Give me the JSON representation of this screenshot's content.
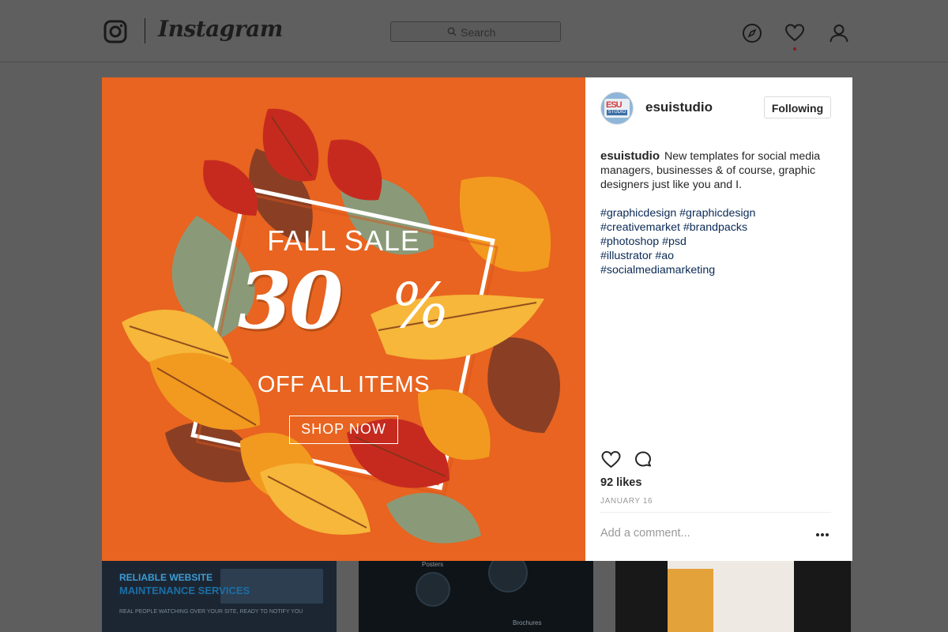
{
  "app": {
    "name": "Instagram",
    "search_placeholder": "Search"
  },
  "post": {
    "username": "esuistudio",
    "follow_label": "Following",
    "avatar_text_top": "ESU",
    "avatar_text_bottom": "STUDIO",
    "caption_user": "esuistudio",
    "caption_text": "New templates for social media managers, businesses & of course, graphic designers just like you and I.",
    "hashtags": [
      "#graphicdesign #graphicdesign",
      "#creativemarket #brandpacks",
      "#photoshop #psd",
      "#illustrator #ao",
      "#socialmediamarketing"
    ],
    "likes": "92 likes",
    "date": "JANUARY 16",
    "comment_placeholder": "Add a comment..."
  },
  "poster": {
    "headline": "FALL SALE",
    "number": "30",
    "percent": "%",
    "subline": "OFF ALL ITEMS",
    "button": "SHOP NOW"
  },
  "thumbs": {
    "t1_top": "RELIABLE WEBSITE",
    "t1_head": "MAINTENANCE SERVICES",
    "t1_sub": "REAL PEOPLE WATCHING OVER YOUR SITE, READY TO NOTIFY YOU",
    "t2_label": "Posters",
    "t2_label2": "Brochures"
  },
  "colors": {
    "poster_bg": "#e86420",
    "leaf_red": "#c62a1f",
    "leaf_brown": "#8a3f24",
    "leaf_olive": "#8a9a78",
    "leaf_orange": "#f29a1f",
    "leaf_yellow": "#f6b73a"
  }
}
